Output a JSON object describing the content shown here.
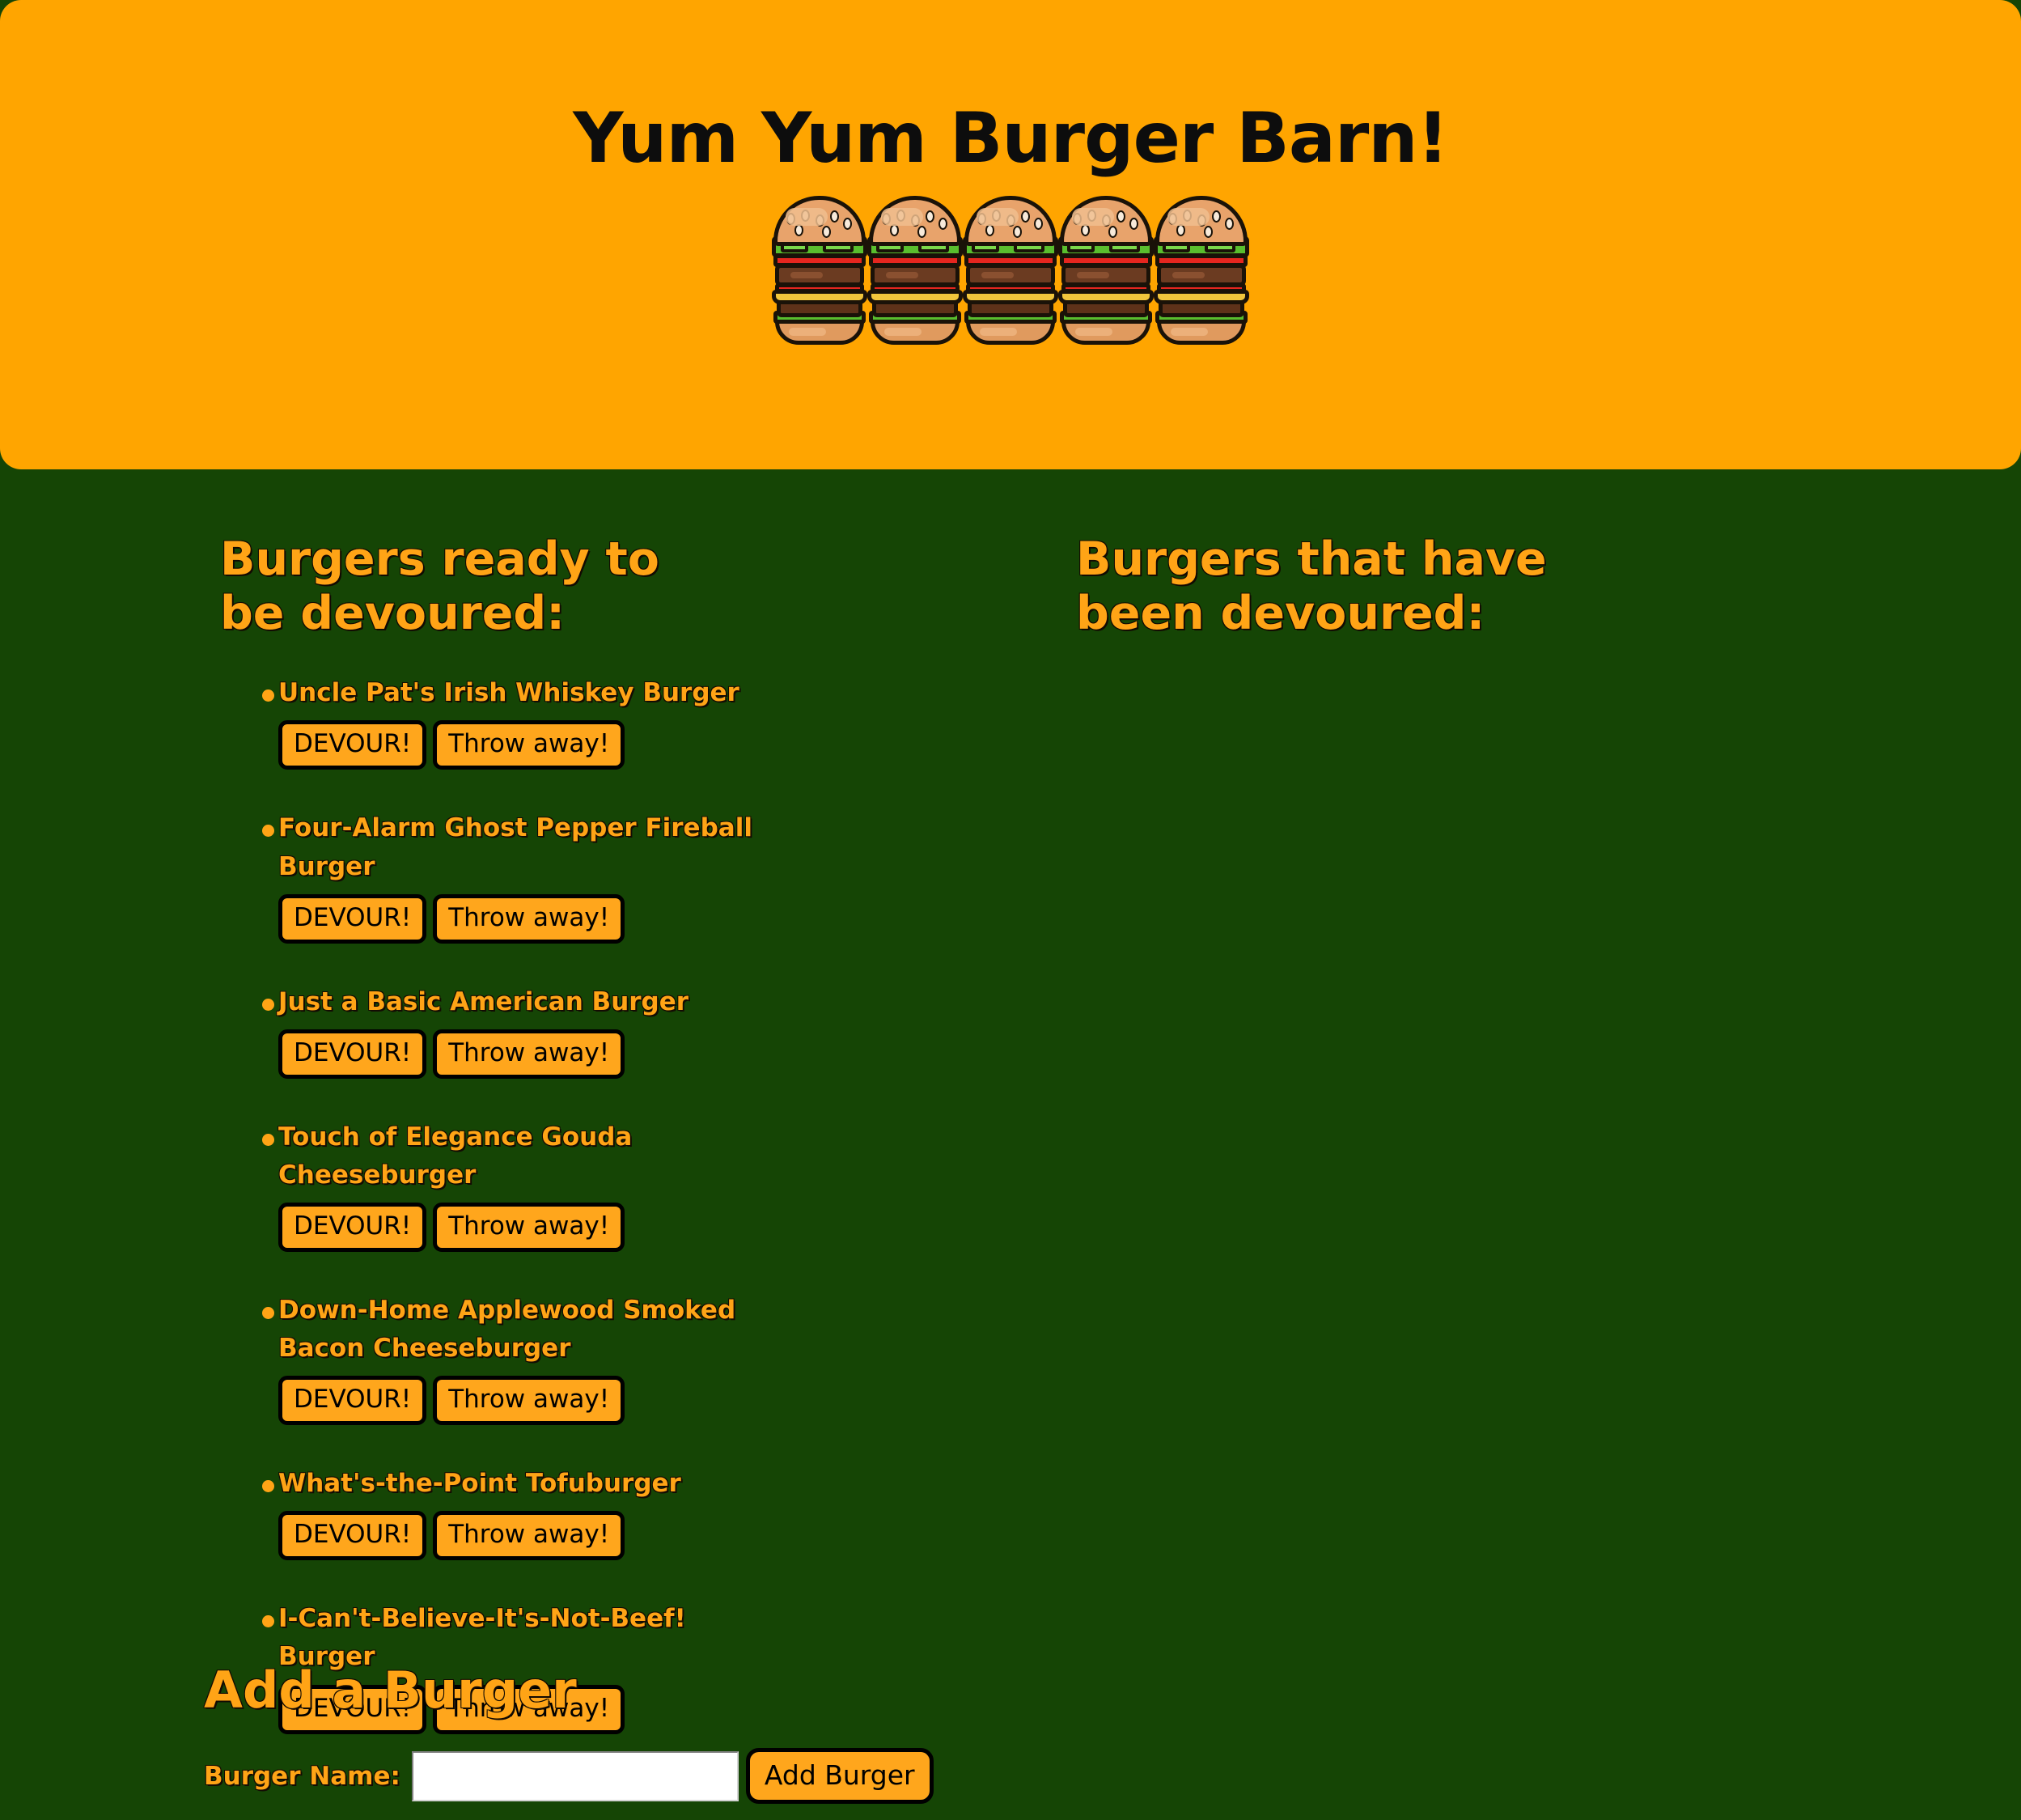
{
  "header": {
    "title": "Yum Yum Burger Barn!",
    "burger_icon_count": 5,
    "burger_icon_name": "hamburger-emoji",
    "background_color": "#FFA500",
    "title_color": "#0d0d0d"
  },
  "theme": {
    "page_background": "#154505",
    "accent_orange": "#FFA416",
    "button_orange": "#FFA61C",
    "outline_black": "#000000"
  },
  "ready_column": {
    "heading": "Burgers ready to be devoured:",
    "burgers": [
      {
        "name": "Uncle Pat's Irish Whiskey Burger",
        "devour_label": "DEVOUR!",
        "throw_away_label": "Throw away!"
      },
      {
        "name": "Four-Alarm Ghost Pepper Fireball Burger",
        "devour_label": "DEVOUR!",
        "throw_away_label": "Throw away!"
      },
      {
        "name": "Just a Basic American Burger",
        "devour_label": "DEVOUR!",
        "throw_away_label": "Throw away!"
      },
      {
        "name": "Touch of Elegance Gouda Cheeseburger",
        "devour_label": "DEVOUR!",
        "throw_away_label": "Throw away!"
      },
      {
        "name": "Down-Home Applewood Smoked Bacon Cheeseburger",
        "devour_label": "DEVOUR!",
        "throw_away_label": "Throw away!"
      },
      {
        "name": "What's-the-Point Tofuburger",
        "devour_label": "DEVOUR!",
        "throw_away_label": "Throw away!"
      },
      {
        "name": "I-Can't-Believe-It's-Not-Beef! Burger",
        "devour_label": "DEVOUR!",
        "throw_away_label": "Throw away!"
      }
    ]
  },
  "devoured_column": {
    "heading": "Burgers that have been devoured:",
    "burgers": []
  },
  "add_form": {
    "heading": "Add a Burger",
    "label": "Burger Name:",
    "input_value": "",
    "input_placeholder": "",
    "submit_label": "Add Burger"
  }
}
